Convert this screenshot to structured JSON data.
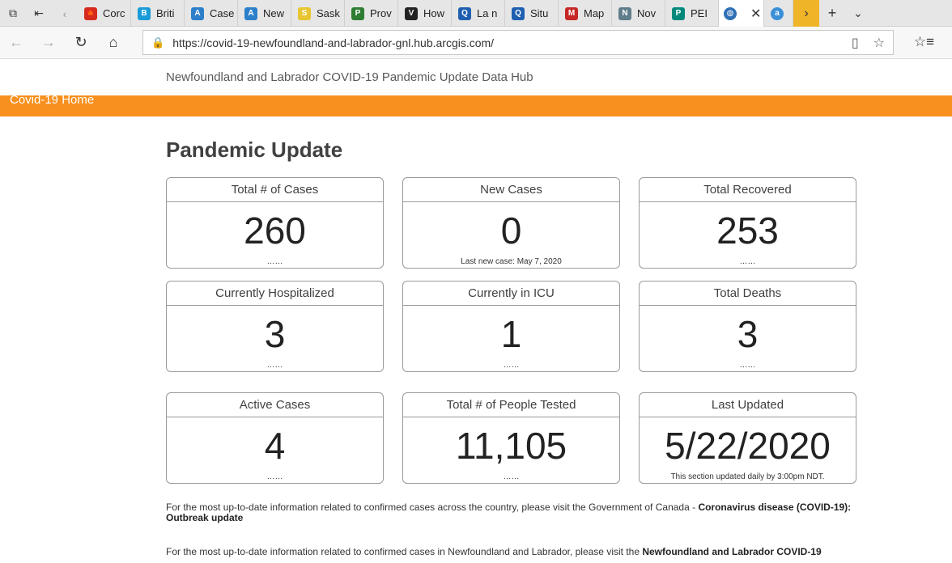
{
  "browser": {
    "tabs": [
      {
        "label": "Corc",
        "fav_color": "#d52b1e",
        "fav_glyph": "🍁"
      },
      {
        "label": "Briti",
        "fav_color": "#1a9bd7",
        "fav_glyph": "B"
      },
      {
        "label": "Case",
        "fav_color": "#2c7fc9",
        "fav_glyph": "A"
      },
      {
        "label": "New",
        "fav_color": "#2c7fc9",
        "fav_glyph": "A"
      },
      {
        "label": "Sask",
        "fav_color": "#e7c632",
        "fav_glyph": "S"
      },
      {
        "label": "Prov",
        "fav_color": "#2e7d32",
        "fav_glyph": "P"
      },
      {
        "label": "How",
        "fav_color": "#222222",
        "fav_glyph": "V"
      },
      {
        "label": "La n",
        "fav_color": "#1f5fb0",
        "fav_glyph": "Q"
      },
      {
        "label": "Situ",
        "fav_color": "#1f5fb0",
        "fav_glyph": "Q"
      },
      {
        "label": "Map",
        "fav_color": "#c62828",
        "fav_glyph": "M"
      },
      {
        "label": "Nov",
        "fav_color": "#607d8b",
        "fav_glyph": "N"
      },
      {
        "label": "PEI",
        "fav_color": "#00897b",
        "fav_glyph": "P"
      }
    ],
    "url": "https://covid-19-newfoundland-and-labrador-gnl.hub.arcgis.com/"
  },
  "site": {
    "title": "Newfoundland and Labrador COVID-19 Pandemic Update Data Hub",
    "home_link": "Covid-19 Home"
  },
  "page": {
    "heading": "Pandemic Update"
  },
  "cards": [
    {
      "label": "Total # of Cases",
      "value": "260",
      "footer": "……"
    },
    {
      "label": "New Cases",
      "value": "0",
      "footer": "Last new case: May 7, 2020"
    },
    {
      "label": "Total Recovered",
      "value": "253",
      "footer": "……"
    },
    {
      "label": "Currently Hospitalized",
      "value": "3",
      "footer": "……"
    },
    {
      "label": "Currently in ICU",
      "value": "1",
      "footer": "……"
    },
    {
      "label": "Total Deaths",
      "value": "3",
      "footer": "……"
    },
    {
      "label": "Active Cases",
      "value": "4",
      "footer": "……"
    },
    {
      "label": "Total # of People Tested",
      "value": "11,105",
      "footer": "……"
    },
    {
      "label": "Last Updated",
      "value": "5/22/2020",
      "footer": "This section updated daily by 3:00pm NDT."
    }
  ],
  "notes": {
    "canada_text": "For the most up-to-date information related to confirmed cases across the country, please visit the Government of Canada - ",
    "canada_link": "Coronavirus disease (COVID-19): Outbreak update",
    "nl_text": "For the most up-to-date information related to confirmed cases in Newfoundland and Labrador, please visit the ",
    "nl_link": "Newfoundland and Labrador COVID-19"
  }
}
